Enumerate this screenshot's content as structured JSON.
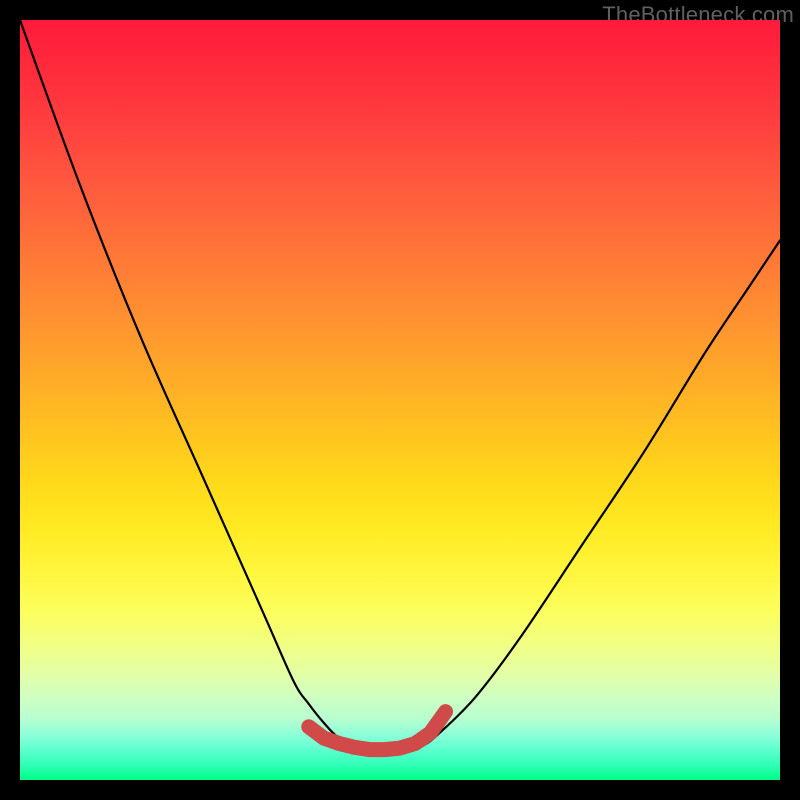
{
  "watermark": "TheBottleneck.com",
  "chart_data": {
    "type": "line",
    "title": "",
    "xlabel": "",
    "ylabel": "",
    "xlim": [
      0,
      100
    ],
    "ylim": [
      0,
      100
    ],
    "grid": false,
    "series": [
      {
        "name": "black-curve",
        "color": "#000000",
        "x": [
          0,
          8,
          16,
          24,
          32,
          36,
          38,
          40,
          42,
          45,
          48,
          51,
          53,
          55,
          60,
          66,
          74,
          82,
          90,
          96,
          100
        ],
        "y": [
          100,
          78,
          58,
          40,
          22,
          13,
          10,
          7.5,
          5.5,
          4.0,
          3.6,
          3.8,
          4.5,
          6,
          11,
          19,
          31,
          43,
          56,
          65,
          71
        ]
      },
      {
        "name": "red-flat-bottom",
        "color": "#d14a4a",
        "x": [
          38,
          40,
          42,
          44,
          46,
          48,
          50,
          52,
          54,
          56
        ],
        "y": [
          7,
          5.5,
          4.8,
          4.3,
          4.0,
          4.0,
          4.2,
          4.8,
          6.2,
          9
        ]
      }
    ]
  }
}
